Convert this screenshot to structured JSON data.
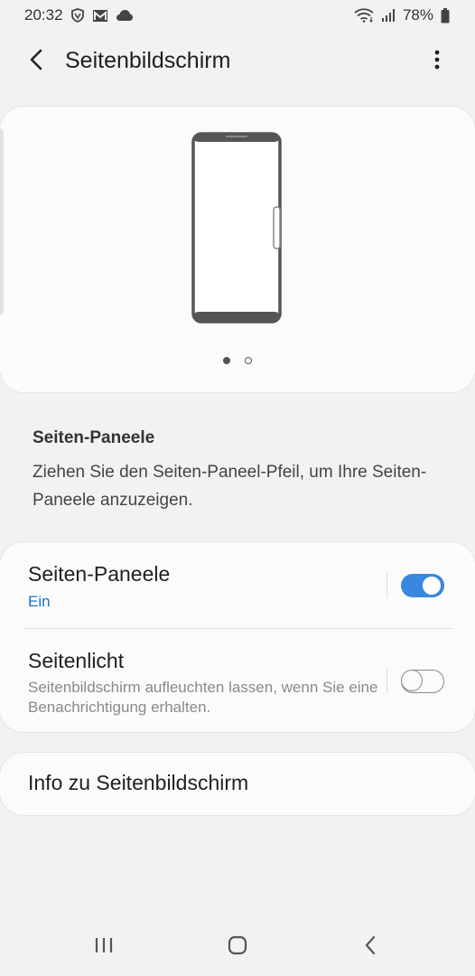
{
  "status_bar": {
    "time": "20:32",
    "battery_percent": "78%",
    "left_icons": [
      "shield-icon",
      "gmail-icon",
      "cloud-icon"
    ],
    "right_icons": [
      "wifi-icon",
      "signal-icon",
      "battery-icon"
    ]
  },
  "app_bar": {
    "title": "Seitenbildschirm",
    "back_icon": "back-arrow-icon",
    "more_icon": "more-vertical-icon"
  },
  "preview": {
    "illustration": "phone-edge-panel-illustration",
    "page_count": 2,
    "current_page": 1
  },
  "description": {
    "title": "Seiten-Paneele",
    "text": "Ziehen Sie den Seiten-Paneel-Pfeil, um Ihre Seiten-Paneele anzuzeigen."
  },
  "settings": [
    {
      "title": "Seiten-Paneele",
      "subtitle": "Ein",
      "enabled": true
    },
    {
      "title": "Seitenlicht",
      "subtitle": "Seitenbildschirm aufleuchten lassen, wenn Sie eine Benachrichtigung erhalten.",
      "enabled": false
    }
  ],
  "info": {
    "label": "Info zu Seitenbildschirm"
  },
  "nav_bar": {
    "buttons": [
      "recents-icon",
      "home-icon",
      "back-icon"
    ]
  },
  "colors": {
    "accent": "#3a87e0",
    "link": "#1b73c8",
    "background": "#f2f2f2",
    "card": "#fbfbfb"
  }
}
